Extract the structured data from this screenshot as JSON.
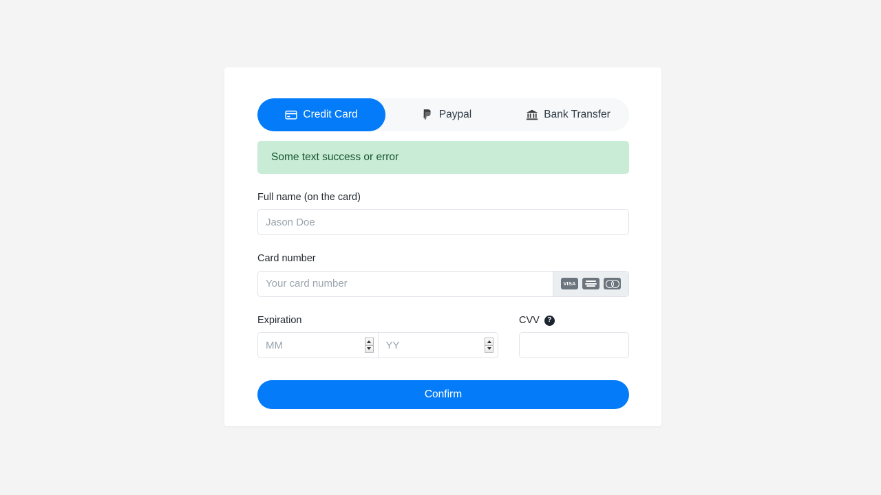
{
  "payment_form": {
    "tabs": [
      {
        "id": "credit-card",
        "label": "Credit Card",
        "icon": "credit-card-icon",
        "active": true
      },
      {
        "id": "paypal",
        "label": "Paypal",
        "icon": "paypal-icon",
        "active": false
      },
      {
        "id": "bank-transfer",
        "label": "Bank Transfer",
        "icon": "bank-icon",
        "active": false
      }
    ],
    "alert": {
      "text": "Some text success or error",
      "background": "#c9ecd7",
      "text_color": "#14532d"
    },
    "fields": {
      "full_name": {
        "label": "Full name (on the card)",
        "placeholder": "Jason Doe",
        "value": ""
      },
      "card_number": {
        "label": "Card number",
        "placeholder": "Your card number",
        "value": "",
        "brands": [
          {
            "id": "visa",
            "label": "VISA"
          },
          {
            "id": "amex",
            "label": "AMERICAN EXPRESS"
          },
          {
            "id": "mastercard",
            "label": "Mastercard"
          }
        ]
      },
      "expiration": {
        "label": "Expiration",
        "month": {
          "placeholder": "MM",
          "value": ""
        },
        "year": {
          "placeholder": "YY",
          "value": ""
        }
      },
      "cvv": {
        "label": "CVV",
        "help_icon": "question-mark-icon",
        "placeholder": "",
        "value": ""
      }
    },
    "confirm_button": {
      "label": "Confirm"
    },
    "accent_color": "#047bf8"
  }
}
